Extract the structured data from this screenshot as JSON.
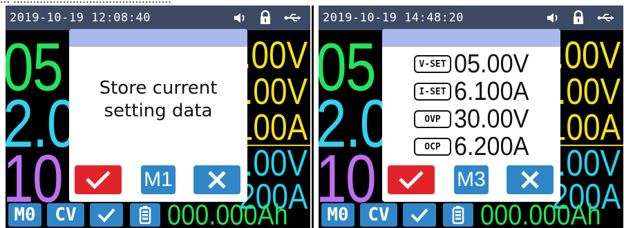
{
  "caption": "... ................................................",
  "screens": [
    {
      "status": {
        "datetime": "2019-10-19 12:08:40",
        "icons": [
          "speaker-icon",
          "lock-icon",
          "usb-icon"
        ]
      },
      "big": {
        "voltage": "05",
        "current": "2.0",
        "power": "10"
      },
      "right": {
        "r1": ".00V",
        "r2": ".00V",
        "r3": "100A",
        "r4": ".00V",
        "r5": "200A"
      },
      "bottom": {
        "mode": "M0",
        "cv": "CV",
        "capacity": "000.000Ah"
      },
      "dialog": {
        "message_line1": "Store current",
        "message_line2": "setting data",
        "memory": "M1"
      }
    },
    {
      "status": {
        "datetime": "2019-10-19 14:48:20",
        "icons": [
          "speaker-icon",
          "lock-icon",
          "usb-icon"
        ]
      },
      "big": {
        "voltage": "05",
        "current": "2.0",
        "power": "10"
      },
      "right": {
        "r1": ".00V",
        "r2": ".00V",
        "r3": "100A",
        "r4": ".00V",
        "r5": "200A"
      },
      "bottom": {
        "mode": "M0",
        "cv": "CV",
        "capacity": "000.000Ah"
      },
      "dialog": {
        "settings": [
          {
            "tag": "V-SET",
            "value": "05.00V"
          },
          {
            "tag": "I-SET",
            "value": "6.100A"
          },
          {
            "tag": "OVP",
            "value": "30.00V"
          },
          {
            "tag": "OCP",
            "value": "6.200A"
          }
        ],
        "memory": "M3"
      }
    }
  ],
  "colors": {
    "status_bar": "#3d4a63",
    "voltage": "#22e45a",
    "current": "#2fd3ef",
    "power": "#c06ef0",
    "yellow": "#f1e21a",
    "chip_blue": "#2f87c7",
    "confirm_red": "#e2242a",
    "dialog_header": "#a8b8ec"
  }
}
